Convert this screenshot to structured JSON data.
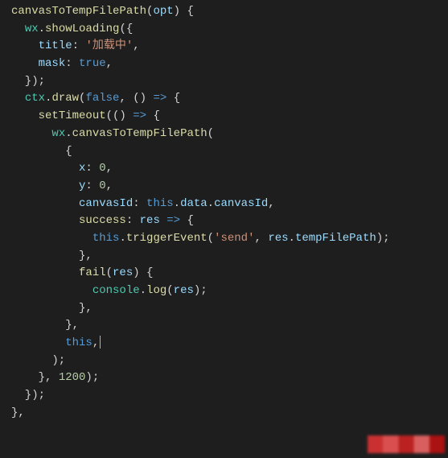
{
  "code": {
    "lines": [
      [
        [
          "fn",
          "canvasToTempFilePath"
        ],
        [
          "pun",
          "("
        ],
        [
          "var",
          "opt"
        ],
        [
          "pun",
          ")"
        ],
        [
          "pun",
          " {"
        ]
      ],
      [
        [
          "pun",
          "  "
        ],
        [
          "obj",
          "wx"
        ],
        [
          "pun",
          "."
        ],
        [
          "fn",
          "showLoading"
        ],
        [
          "pun",
          "({"
        ]
      ],
      [
        [
          "pun",
          "    "
        ],
        [
          "var",
          "title"
        ],
        [
          "pun",
          ": "
        ],
        [
          "str",
          "'加载中'"
        ],
        [
          "pun",
          ","
        ]
      ],
      [
        [
          "pun",
          "    "
        ],
        [
          "var",
          "mask"
        ],
        [
          "pun",
          ": "
        ],
        [
          "kw",
          "true"
        ],
        [
          "pun",
          ","
        ]
      ],
      [
        [
          "pun",
          "  });"
        ]
      ],
      [
        [
          "pun",
          "  "
        ],
        [
          "obj",
          "ctx"
        ],
        [
          "pun",
          "."
        ],
        [
          "fn",
          "draw"
        ],
        [
          "pun",
          "("
        ],
        [
          "kw",
          "false"
        ],
        [
          "pun",
          ", () "
        ],
        [
          "kw",
          "=>"
        ],
        [
          "pun",
          " {"
        ]
      ],
      [
        [
          "pun",
          "    "
        ],
        [
          "fn",
          "setTimeout"
        ],
        [
          "pun",
          "(() "
        ],
        [
          "kw",
          "=>"
        ],
        [
          "pun",
          " {"
        ]
      ],
      [
        [
          "pun",
          "      "
        ],
        [
          "obj",
          "wx"
        ],
        [
          "pun",
          "."
        ],
        [
          "fn",
          "canvasToTempFilePath"
        ],
        [
          "pun",
          "("
        ]
      ],
      [
        [
          "pun",
          "        {"
        ]
      ],
      [
        [
          "pun",
          "          "
        ],
        [
          "var",
          "x"
        ],
        [
          "pun",
          ": "
        ],
        [
          "num",
          "0"
        ],
        [
          "pun",
          ","
        ]
      ],
      [
        [
          "pun",
          "          "
        ],
        [
          "var",
          "y"
        ],
        [
          "pun",
          ": "
        ],
        [
          "num",
          "0"
        ],
        [
          "pun",
          ","
        ]
      ],
      [
        [
          "pun",
          "          "
        ],
        [
          "var",
          "canvasId"
        ],
        [
          "pun",
          ": "
        ],
        [
          "kw",
          "this"
        ],
        [
          "pun",
          "."
        ],
        [
          "var",
          "data"
        ],
        [
          "pun",
          "."
        ],
        [
          "var",
          "canvasId"
        ],
        [
          "pun",
          ","
        ]
      ],
      [
        [
          "pun",
          "          "
        ],
        [
          "fn",
          "success"
        ],
        [
          "pun",
          ": "
        ],
        [
          "var",
          "res"
        ],
        [
          "pun",
          " "
        ],
        [
          "kw",
          "=>"
        ],
        [
          "pun",
          " {"
        ]
      ],
      [
        [
          "pun",
          "            "
        ],
        [
          "kw",
          "this"
        ],
        [
          "pun",
          "."
        ],
        [
          "fn",
          "triggerEvent"
        ],
        [
          "pun",
          "("
        ],
        [
          "str",
          "'send'"
        ],
        [
          "pun",
          ", "
        ],
        [
          "var",
          "res"
        ],
        [
          "pun",
          "."
        ],
        [
          "var",
          "tempFilePath"
        ],
        [
          "pun",
          ");"
        ]
      ],
      [
        [
          "pun",
          "          },"
        ]
      ],
      [
        [
          "pun",
          "          "
        ],
        [
          "fn",
          "fail"
        ],
        [
          "pun",
          "("
        ],
        [
          "var",
          "res"
        ],
        [
          "pun",
          ") {"
        ]
      ],
      [
        [
          "pun",
          "            "
        ],
        [
          "obj",
          "console"
        ],
        [
          "pun",
          "."
        ],
        [
          "fn",
          "log"
        ],
        [
          "pun",
          "("
        ],
        [
          "var",
          "res"
        ],
        [
          "pun",
          ");"
        ]
      ],
      [
        [
          "pun",
          "          },"
        ]
      ],
      [
        [
          "pun",
          "        },"
        ]
      ],
      [
        [
          "pun",
          "        "
        ],
        [
          "kw",
          "this"
        ],
        [
          "pun",
          ","
        ],
        [
          "cursor",
          ""
        ]
      ],
      [
        [
          "pun",
          "      );"
        ]
      ],
      [
        [
          "pun",
          "    }, "
        ],
        [
          "num",
          "1200"
        ],
        [
          "pun",
          ");"
        ]
      ],
      [
        [
          "pun",
          "  });"
        ]
      ],
      [
        [
          "pun",
          "},"
        ]
      ]
    ]
  }
}
